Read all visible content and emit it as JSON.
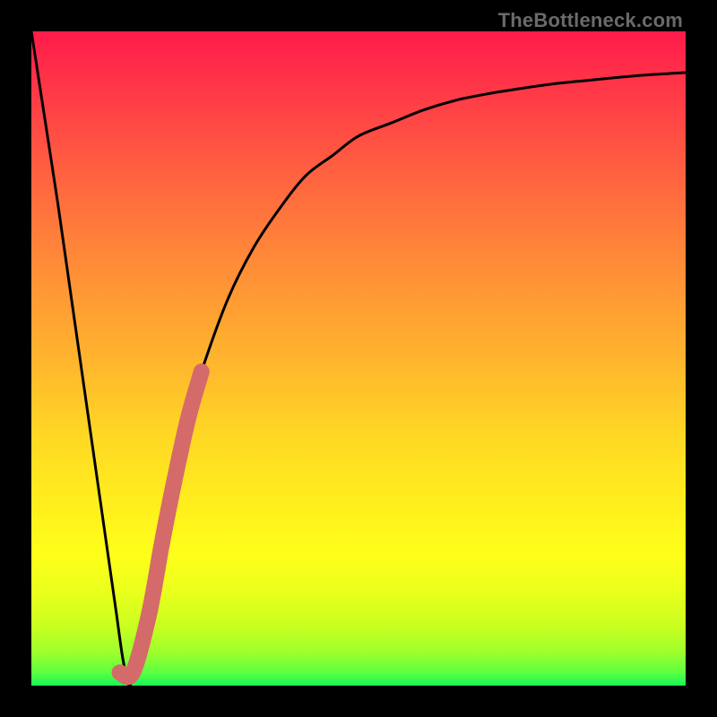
{
  "watermark": "TheBottleneck.com",
  "colors": {
    "frame": "#000000",
    "curve_stroke": "#000000",
    "highlight_stroke": "#d46a6a"
  },
  "chart_data": {
    "type": "line",
    "title": "",
    "xlabel": "",
    "ylabel": "",
    "xlim": [
      0,
      100
    ],
    "ylim": [
      0,
      100
    ],
    "grid": false,
    "legend": false,
    "series": [
      {
        "name": "bottleneck-curve",
        "x": [
          0,
          2,
          4,
          6,
          8,
          10,
          12,
          13,
          14,
          15,
          16,
          18,
          20,
          22,
          24,
          26,
          30,
          34,
          38,
          42,
          46,
          50,
          55,
          60,
          65,
          70,
          75,
          80,
          85,
          90,
          95,
          100
        ],
        "values": [
          100,
          87,
          74,
          60,
          46,
          32,
          18,
          11,
          4,
          0,
          4,
          11,
          22,
          32,
          41,
          48,
          59,
          67,
          73,
          78,
          81,
          84,
          86,
          88,
          89.5,
          90.5,
          91.3,
          92,
          92.5,
          93,
          93.4,
          93.7
        ]
      },
      {
        "name": "highlight-segment",
        "x": [
          13.5,
          15.5,
          18,
          20,
          22,
          24,
          26
        ],
        "values": [
          2,
          2,
          11,
          22,
          32,
          41,
          48
        ]
      }
    ]
  }
}
